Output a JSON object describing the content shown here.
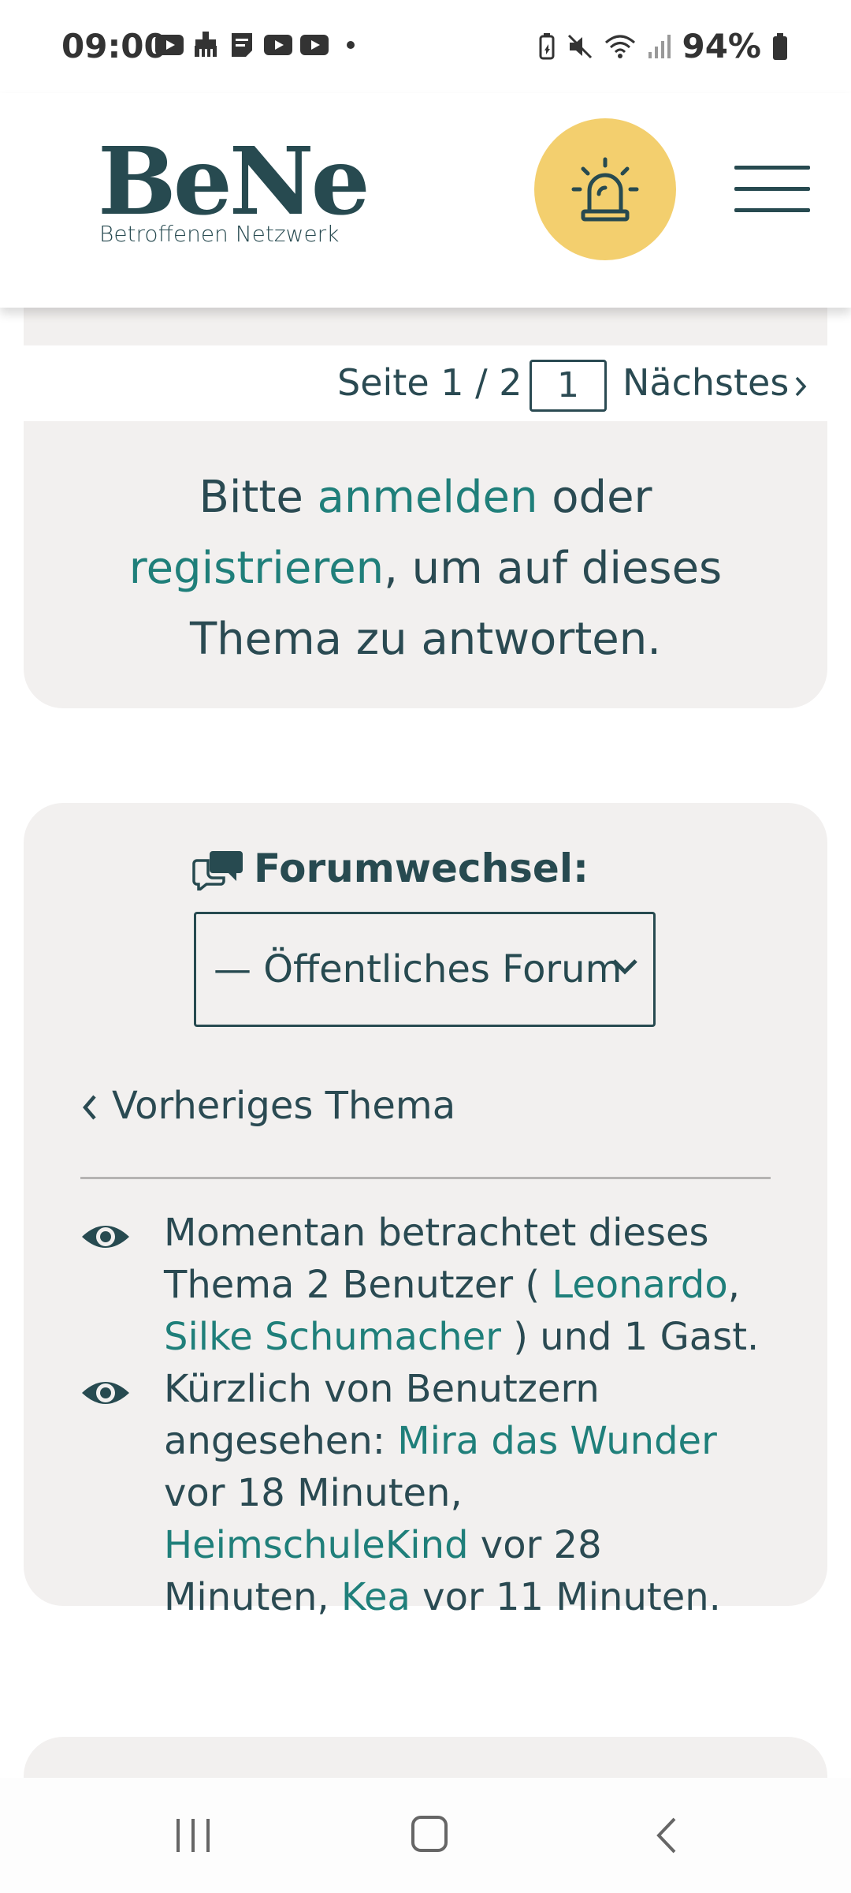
{
  "status_bar": {
    "time": "09:00",
    "battery": "94%",
    "icons_left": [
      "youtube-icon",
      "cleaner-icon",
      "notes-icon",
      "youtube-icon",
      "youtube-icon"
    ],
    "icons_right": [
      "battery-saver-icon",
      "mute-icon",
      "wifi-icon",
      "signal-icon",
      "battery-icon"
    ]
  },
  "header": {
    "logo_main": "BeNe",
    "logo_sub": "Betroffenen Netzwerk",
    "alarm_icon": "alarm-light-icon",
    "menu_icon": "hamburger-menu-icon",
    "colors": {
      "accent_yellow": "#f3cf6e",
      "brand_dark": "#274a50",
      "link": "#1f7f7a"
    }
  },
  "pagination": {
    "label": "Seite 1 / 2",
    "page_value": "1",
    "next_label": "Nächstes"
  },
  "login_prompt": {
    "part1": "Bitte ",
    "login_link": "anmelden",
    "part2": " oder",
    "register_link": "registrieren",
    "part3": ", um auf dieses Thema zu antworten."
  },
  "forum_switch": {
    "title": "Forumwechsel:",
    "selected": "— Öffentliches Forum",
    "prev_topic": "Vorheriges Thema"
  },
  "viewers": {
    "current": {
      "text1": "Momentan betrachtet dieses Thema 2 Benutzer ( ",
      "user1": "Leonardo",
      "sep": ", ",
      "user2": "Silke Schumacher",
      "text2": " ) und 1 Gast."
    },
    "recent": {
      "text1": "Kürzlich von Benutzern angesehen:  ",
      "user1": "Mira das Wunder",
      "time1": "  vor 18 Minuten,  ",
      "user2": "HeimschuleKind",
      "time2": "  vor 28 Minuten,  ",
      "user3": "Kea",
      "time3": "  vor 11 Minuten."
    }
  }
}
